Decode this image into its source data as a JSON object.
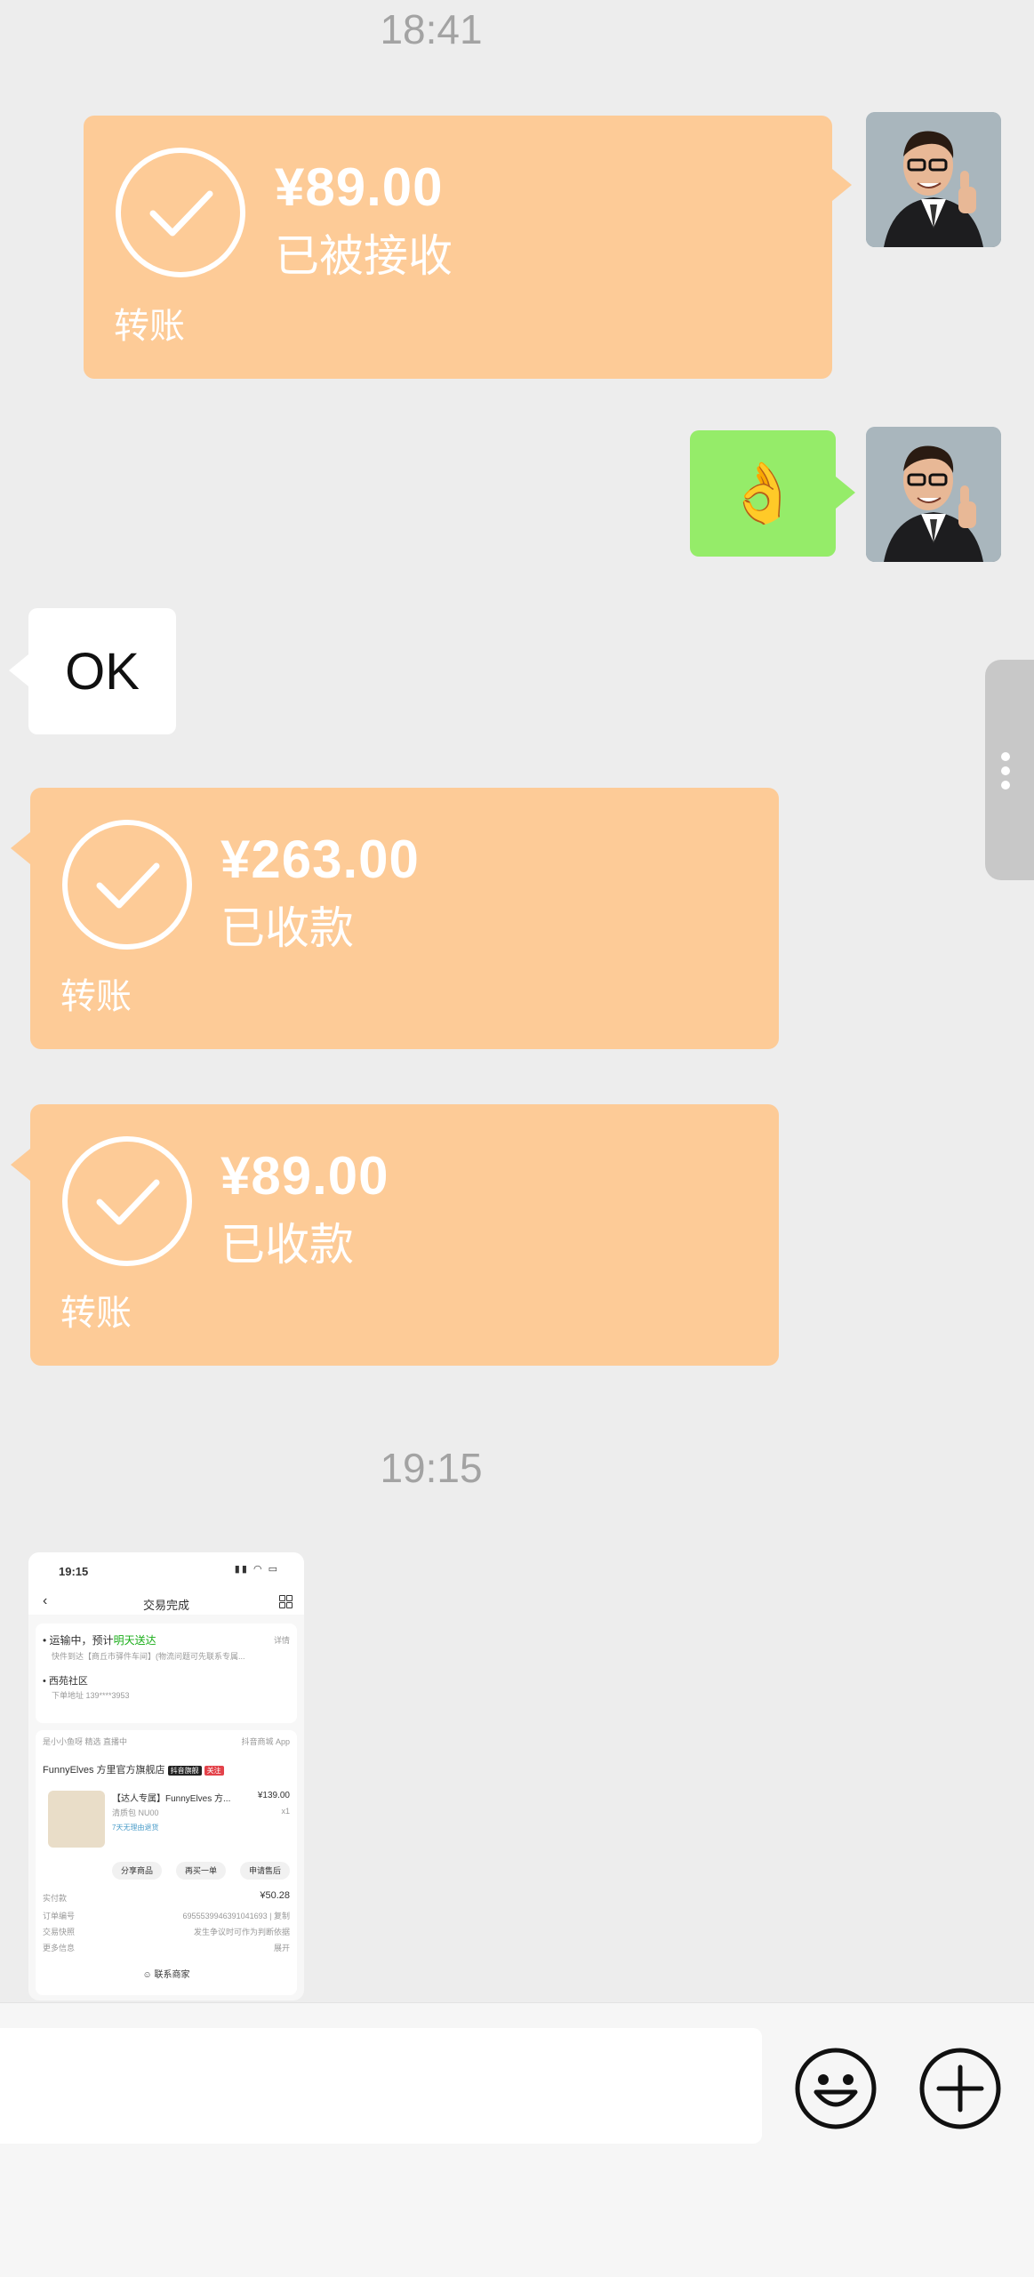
{
  "chat": {
    "timestamp_1": "18:41",
    "timestamp_2": "19:15",
    "transfer_sent": {
      "amount": "¥89.00",
      "status": "已被接收",
      "label": "转账"
    },
    "emoji_message": "👌",
    "text_message": "OK",
    "transfer_received_1": {
      "amount": "¥263.00",
      "status": "已收款",
      "label": "转账"
    },
    "transfer_received_2": {
      "amount": "¥89.00",
      "status": "已收款",
      "label": "转账"
    }
  },
  "screenshot": {
    "status_time": "19:15",
    "page_title": "交易完成",
    "shipping_status": "运输中，预计",
    "shipping_eta": "明天送达",
    "shipping_detail_link": "详情",
    "shipping_note": "快件到达【商丘市驿件车间】(物流问题可先联系专属...",
    "address_area": "西苑社区",
    "address_detail": "下单地址 139****3953",
    "shop_label": "是小小鱼呀 精选 直播中",
    "app_link": "抖音商城 App",
    "shop_name": "FunnyElves 方里官方旗舰店",
    "shop_badge": "抖音旗舰",
    "shop_badge_2": "关注",
    "product_title": "【达人专属】FunnyElves 方...",
    "product_price": "¥139.00",
    "product_spec": "清质包 NU00",
    "product_qty": "x1",
    "product_tag": "7天无理由退货",
    "btn_share": "分享商品",
    "btn_rebuy": "再买一单",
    "btn_after_sale": "申请售后",
    "paid_label": "实付款",
    "paid_value": "¥50.28",
    "order_no_label": "订单编号",
    "order_no_value": "6955539946391041693 | 复制",
    "snapshot_label": "交易快照",
    "snapshot_value": "发生争议时可作为判断依据",
    "more_label": "更多信息",
    "more_value": "展开",
    "contact_button": "联系商家"
  },
  "colors": {
    "transfer_bg": "#fdcb97",
    "own_bubble": "#95ec69",
    "background": "#ededed"
  },
  "icons": {
    "emoji_button": "smiley-face-icon",
    "plus_button": "plus-circle-icon",
    "transfer_check": "check-circle-icon"
  }
}
